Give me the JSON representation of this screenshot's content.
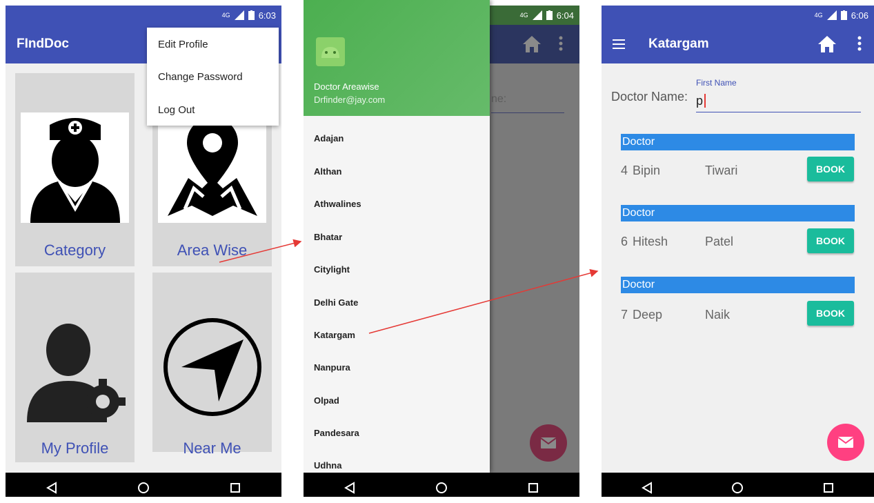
{
  "screen1": {
    "status": {
      "signal": "4G",
      "time": "6:03"
    },
    "app_title": "FIndDoc",
    "menu": [
      "Edit Profile",
      "Change Password",
      "Log Out"
    ],
    "tiles": [
      {
        "label": "Category",
        "icon": "doctor-icon"
      },
      {
        "label": "Area Wise",
        "icon": "map-pin-icon"
      },
      {
        "label": "My Profile",
        "icon": "user-settings-icon"
      },
      {
        "label": "Near Me",
        "icon": "navigation-icon"
      }
    ]
  },
  "screen2": {
    "status": {
      "signal": "4G",
      "time": "6:04"
    },
    "drawer_header": {
      "name": "Doctor Areawise",
      "email": "Drfinder@jay.com"
    },
    "areas": [
      "Adajan",
      "Althan",
      "Athwalines",
      "Bhatar",
      "Citylight",
      "Delhi Gate",
      "Katargam",
      "Nanpura",
      "Olpad",
      "Pandesara",
      "Udhna"
    ],
    "hint_fragment": "ne:"
  },
  "screen3": {
    "status": {
      "signal": "4G",
      "time": "6:06"
    },
    "title": "Katargam",
    "search": {
      "label": "Doctor Name:",
      "float_label": "First Name",
      "value": "p"
    },
    "results": [
      {
        "header": "Doctor",
        "id": "4",
        "first": "Bipin",
        "last": "Tiwari",
        "button": "BOOK"
      },
      {
        "header": "Doctor",
        "id": "6",
        "first": "Hitesh",
        "last": "Patel",
        "button": "BOOK"
      },
      {
        "header": "Doctor",
        "id": "7",
        "first": "Deep",
        "last": "Naik",
        "button": "BOOK"
      }
    ]
  },
  "colors": {
    "primary": "#3f51b5",
    "drawer_green": "#4caf50",
    "row_blue": "#2d8ae5",
    "book_teal": "#1abc9c",
    "fab_pink": "#ff4081",
    "arrow": "#e53935"
  }
}
